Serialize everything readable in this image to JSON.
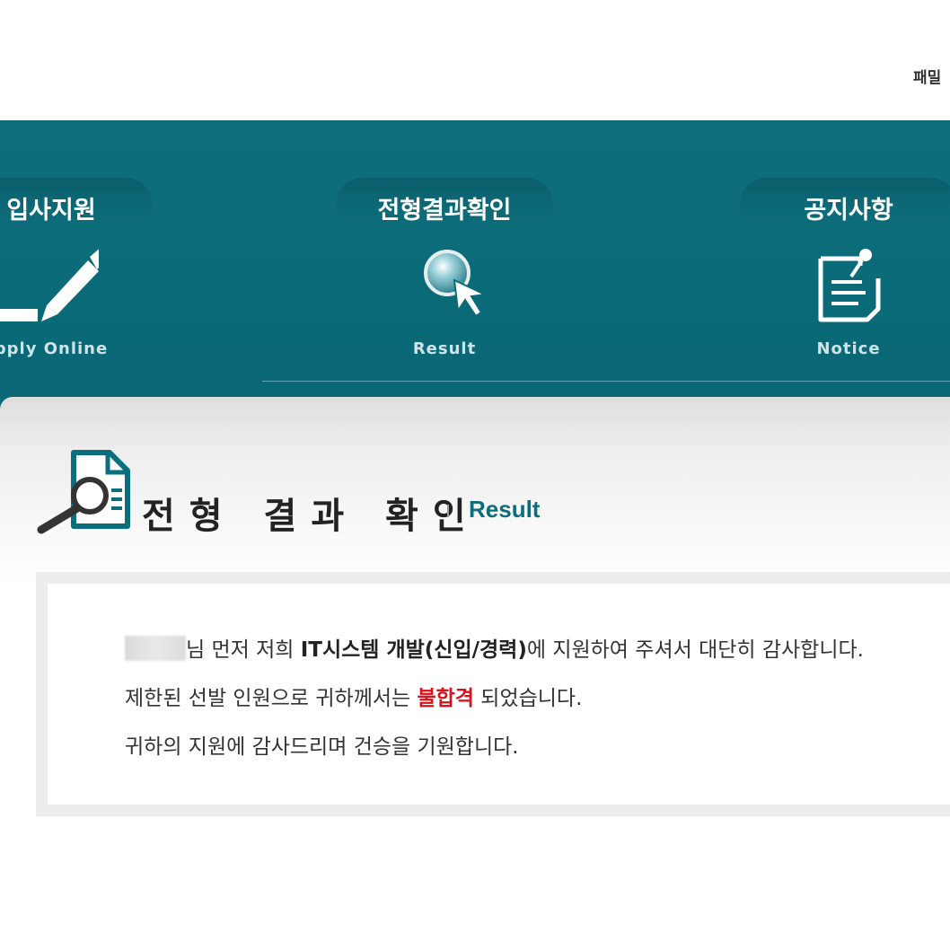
{
  "header": {
    "family_link": "패밀"
  },
  "nav": {
    "items": [
      {
        "title": "입사지원",
        "subtitle": "pply Online",
        "icon": "pencil-icon"
      },
      {
        "title": "전형결과확인",
        "subtitle": "Result",
        "icon": "magnifier-cursor-icon"
      },
      {
        "title": "공지사항",
        "subtitle": "Notice",
        "icon": "notepad-icon"
      }
    ]
  },
  "section": {
    "title": "전형 결과 확인",
    "subtitle": "Result",
    "icon": "document-search-icon"
  },
  "message": {
    "line1_suffix": "님 먼저 저희 ",
    "line1_position": "IT시스템 개발(신입/경력)",
    "line1_end": "에 지원하여 주셔서 대단히 감사합니다.",
    "line2_start": "제한된 선발 인원으로 귀하께서는 ",
    "line2_result": "불합격",
    "line2_end": " 되었습니다.",
    "line3": "귀하의 지원에 감사드리며 건승을 기원합니다."
  },
  "colors": {
    "nav_background": "#0b6b79",
    "accent_teal": "#0b6e7c",
    "fail_red": "#d8121b"
  }
}
